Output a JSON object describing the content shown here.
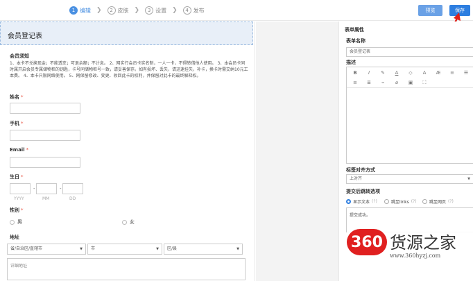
{
  "steps": [
    {
      "num": "1",
      "label": "编辑"
    },
    {
      "num": "2",
      "label": "皮肤"
    },
    {
      "num": "3",
      "label": "设置"
    },
    {
      "num": "4",
      "label": "发布"
    }
  ],
  "toolbar": {
    "preview_label": "预览",
    "save_label": "保存"
  },
  "form": {
    "title": "会员登记表",
    "notice_title": "会员须知",
    "notice_text": "1、本卡不兑换现金；不能透支；可退余额；不计息。 2、网实行会员卡实名制，一人一卡，不得转借他人使用。 3、本会员卡同时属开启会员专属储物柜的钥匙，卡号同储物柜号一致，请妥善保存。如有损坏、丢失，请迅速挂失，补卡，换卡时需交纳10元工本费。 4、本卡只限网络使用。 5、网保留修改、变更、收回此卡的权利，并保留对此卡的最终解释权。",
    "name_label": "姓名",
    "phone_label": "手机",
    "email_label": "Email",
    "birthday_label": "生日",
    "birthday_hints": {
      "year": "YYYY",
      "month": "MM",
      "day": "DD"
    },
    "gender_label": "性别",
    "gender_options": [
      "男",
      "女"
    ],
    "address_label": "地址",
    "province_placeholder": "省/自治区/直辖市",
    "city_placeholder": "市",
    "district_placeholder": "区/县",
    "address_detail_placeholder": "详细地址",
    "required_mark": "*",
    "date_sep": "-"
  },
  "props": {
    "title": "表单属性",
    "name_label": "表单名称",
    "name_value": "会员登记表",
    "desc_label": "描述",
    "align_label": "标签对齐方式",
    "align_value": "上对齐",
    "submit_label": "提交后跳转选项",
    "submit_options": [
      {
        "label": "显示文本",
        "hint": "(?)"
      },
      {
        "label": "跳至links",
        "hint": "(?)"
      },
      {
        "label": "跳至网页",
        "hint": "(?)"
      }
    ],
    "submit_text": "提交成功。"
  },
  "watermark": {
    "badge": "360",
    "name": "货源之家",
    "url": "www.360hyzj.com"
  },
  "colors": {
    "accent": "#2d7ee0",
    "header_bg": "#e8eff8",
    "required": "#e74c3c",
    "logo_red": "#e02020"
  }
}
